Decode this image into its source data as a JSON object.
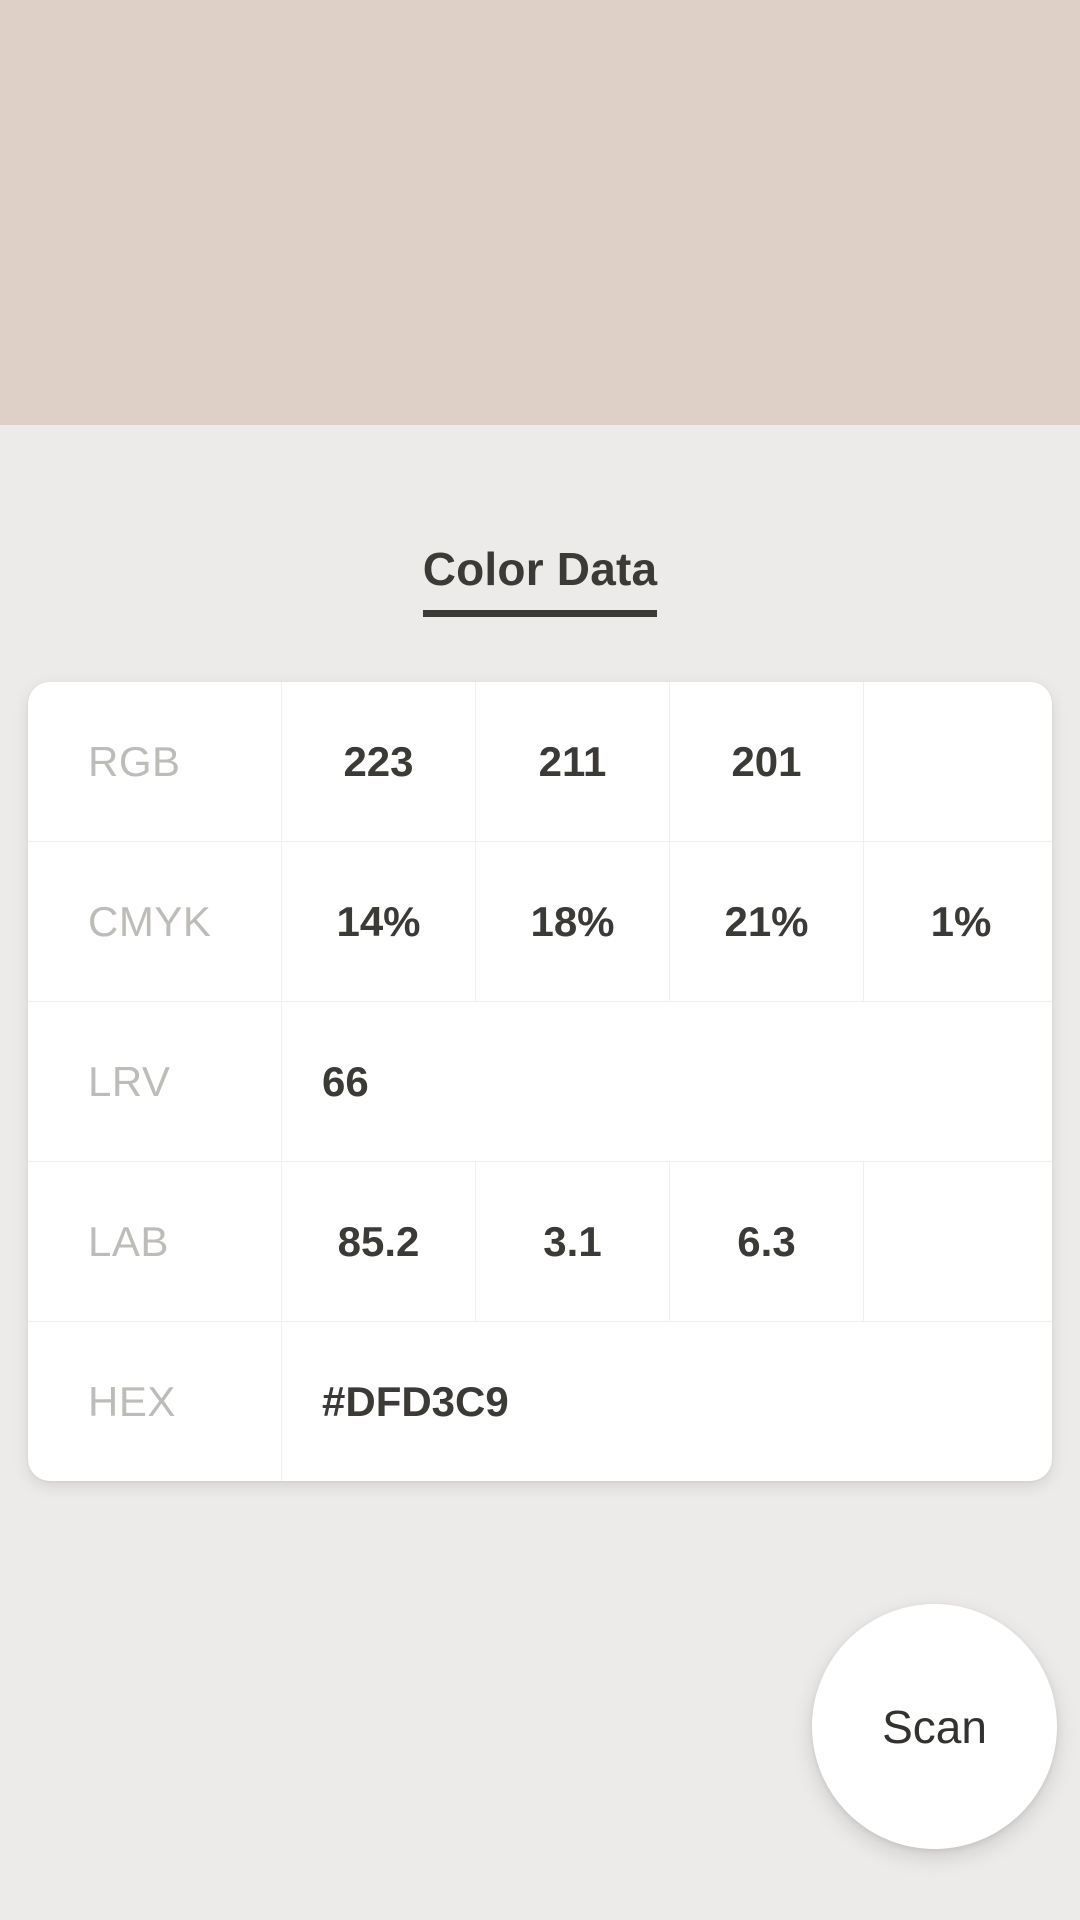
{
  "swatch": {
    "name": "color-preview-swatch",
    "color": "#DED0C7"
  },
  "header": {
    "title": "Color Data"
  },
  "table": {
    "rows": [
      {
        "label": "RGB",
        "values": [
          "223",
          "211",
          "201",
          ""
        ],
        "layout": "quad"
      },
      {
        "label": "CMYK",
        "values": [
          "14%",
          "18%",
          "21%",
          "1%"
        ],
        "layout": "quad"
      },
      {
        "label": "LRV",
        "values": [
          "66"
        ],
        "layout": "single"
      },
      {
        "label": "LAB",
        "values": [
          "85.2",
          "3.1",
          "6.3",
          ""
        ],
        "layout": "quad"
      },
      {
        "label": "HEX",
        "values": [
          "#DFD3C9"
        ],
        "layout": "single"
      }
    ]
  },
  "scan_button": {
    "label": "Scan"
  },
  "colors": {
    "background": "#ECEBE9",
    "card": "#FFFFFF",
    "text_primary": "#3B3A37",
    "text_muted": "#BDBCB9",
    "divider": "#F1F0EE"
  }
}
